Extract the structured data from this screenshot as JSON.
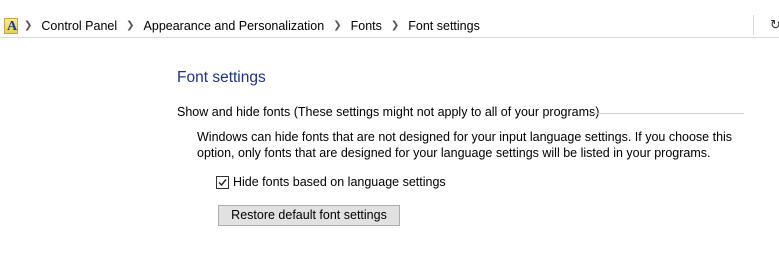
{
  "window": {
    "app_icon": "fonts-folder-icon",
    "app_icon_glyph": "A",
    "refresh_icon": "refresh-icon"
  },
  "breadcrumb": {
    "items": [
      {
        "label": "Control Panel"
      },
      {
        "label": "Appearance and Personalization"
      },
      {
        "label": "Fonts"
      },
      {
        "label": "Font settings"
      }
    ]
  },
  "main": {
    "title": "Font settings",
    "group_heading": "Show and hide fonts (These settings might not apply to all of your programs)",
    "description": "Windows can hide fonts that are not designed for your input language settings. If you choose this option, only fonts that are designed for your language settings will be listed in your programs.",
    "hide_fonts_checkbox": {
      "label": "Hide fonts based on language settings",
      "checked": true
    },
    "restore_button_label": "Restore default font settings"
  },
  "colors": {
    "title": "#1e3287",
    "button_bg": "#e1e1e1",
    "button_border": "#adadad"
  }
}
